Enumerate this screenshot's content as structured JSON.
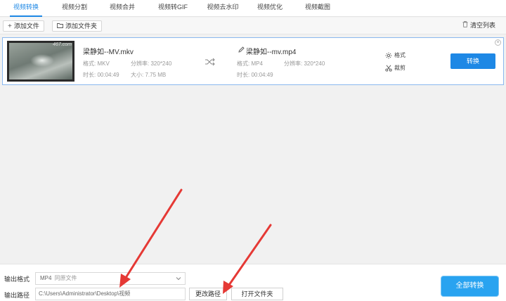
{
  "tabs": [
    {
      "label": "视频转换",
      "active": true
    },
    {
      "label": "视频分割"
    },
    {
      "label": "视频合并"
    },
    {
      "label": "视频转GIF"
    },
    {
      "label": "视频去水印"
    },
    {
      "label": "视频优化"
    },
    {
      "label": "视频截图"
    }
  ],
  "toolbar": {
    "add_file": "添加文件",
    "add_folder": "添加文件夹",
    "clear_list": "清空列表"
  },
  "file": {
    "thumb_watermark": "467.com",
    "source": {
      "name": "梁静如--MV.mkv",
      "format_label": "格式:",
      "format": "MKV",
      "resolution_label": "分辨率:",
      "resolution": "320*240",
      "duration_label": "时长:",
      "duration": "00:04:49",
      "size_label": "大小:",
      "size": "7.75 MB"
    },
    "output": {
      "name": "梁静如--mv.mp4",
      "format_label": "格式:",
      "format": "MP4",
      "resolution_label": "分辨率:",
      "resolution": "320*240",
      "duration_label": "时长:",
      "duration": "00:04:49"
    },
    "options": {
      "format": "格式",
      "trim": "裁剪"
    },
    "convert": "转换"
  },
  "bottom": {
    "output_format_label": "输出格式",
    "output_format_value": "MP4",
    "output_format_sub": "同原文件",
    "output_path_label": "输出路径",
    "output_path_value": "C:\\Users\\Administrator\\Desktop\\视频",
    "change_path": "更改路径",
    "open_folder": "打开文件夹",
    "convert_all": "全部转换"
  },
  "colors": {
    "accent": "#1e88e5",
    "convert_all": "#29a3f0",
    "annotation": "#e53935"
  }
}
